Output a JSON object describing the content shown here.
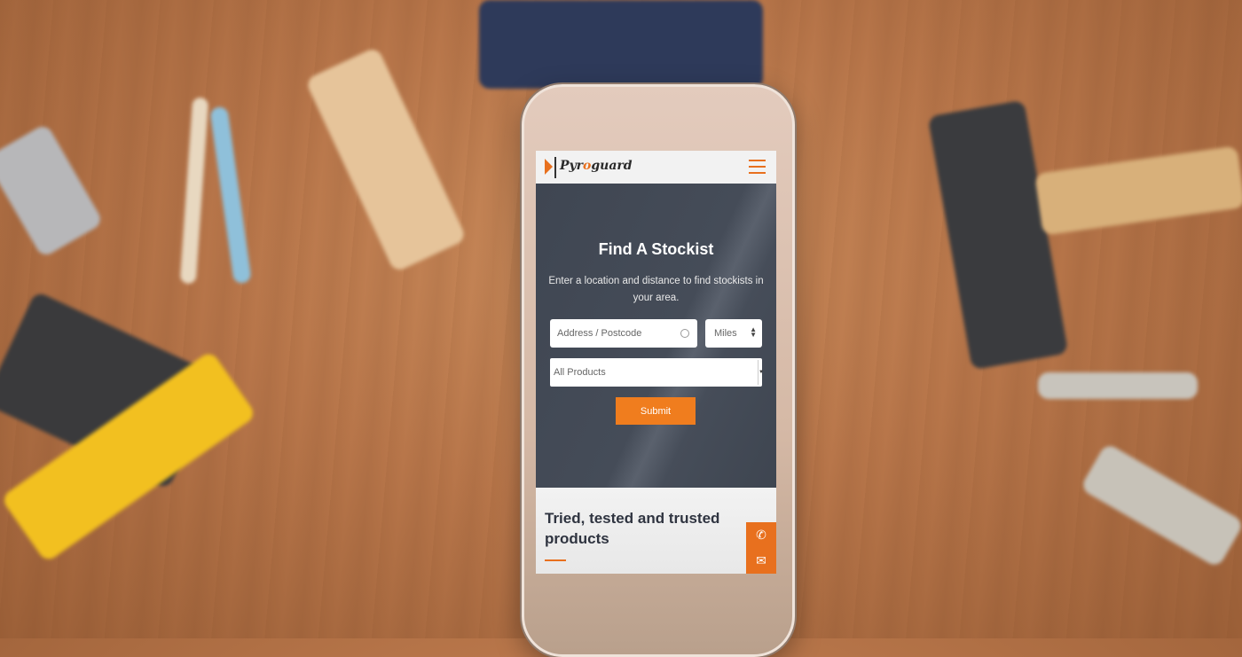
{
  "site": {
    "brand_prefix": "Pyr",
    "brand_o": "o",
    "brand_suffix": "guard",
    "menu_icon": "hamburger-icon"
  },
  "hero": {
    "title": "Find A Stockist",
    "subtitle": "Enter a location and distance to find stockists in your area.",
    "address_placeholder": "Address / Postcode",
    "distance_value": "Miles",
    "product_value": "All Products",
    "submit_label": "Submit"
  },
  "section": {
    "heading": "Tried, tested and trusted products"
  },
  "contact": {
    "phone_icon": "✆",
    "email_icon": "✉"
  },
  "colors": {
    "accent": "#e8701e",
    "hero_bg": "#454c58"
  }
}
